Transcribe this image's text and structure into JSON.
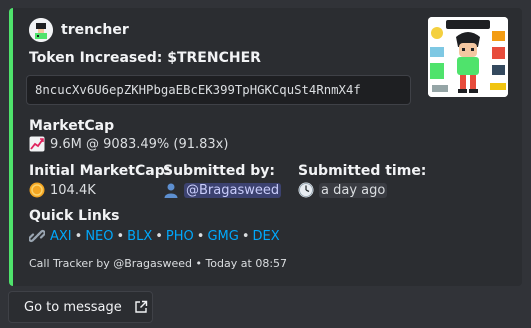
{
  "embed": {
    "accent_color": "#4fe36c",
    "author": {
      "name": "trencher",
      "icon": "bot-avatar-icon"
    },
    "title": "Token Increased: $TRENCHER",
    "address": "8ncucXv6U6epZKHPbgaEBcEK399TpHGKCquSt4RnmX4f",
    "fields": {
      "marketcap": {
        "label": "MarketCap",
        "icon": "chart-increasing-icon",
        "value": "9.6M @ 9083.49% (91.83x)"
      },
      "initial_marketcap": {
        "label": "Initial MarketCap:",
        "icon": "coin-icon",
        "value": "104.4K"
      },
      "submitted_by": {
        "label": "Submitted by:",
        "icon": "bust-silhouette-icon",
        "value": "@Bragasweed"
      },
      "submitted_time": {
        "label": "Submitted time:",
        "icon": "clock-icon",
        "value": "a day ago"
      }
    },
    "quick_links": {
      "label": "Quick Links",
      "icon": "link-icon",
      "links": [
        "AXI",
        "NEO",
        "BLX",
        "PHO",
        "GMG",
        "DEX"
      ],
      "separator": "•"
    },
    "footer": "Call Tracker by @Bragasweed • Today at 08:57",
    "thumbnail": "token-thumbnail-image"
  },
  "goto_button": {
    "label": "Go to message",
    "icon": "external-link-icon"
  }
}
